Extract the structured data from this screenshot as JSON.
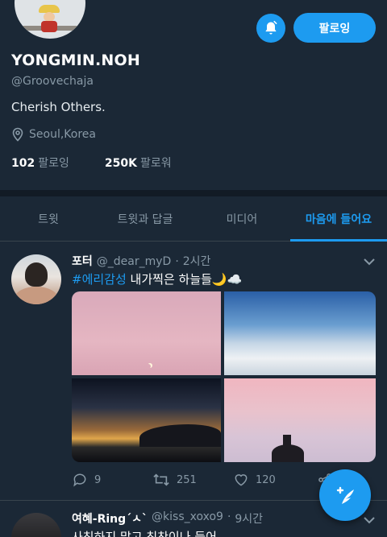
{
  "profile": {
    "name": "YONGMIN.NOH",
    "handle": "@Groovechaja",
    "bio": "Cherish Others.",
    "location": "Seoul,Korea",
    "following_count": "102",
    "following_label": "팔로잉",
    "followers_count": "250K",
    "followers_label": "팔로워",
    "follow_button_label": "팔로잉"
  },
  "tabs": [
    {
      "label": "트윗"
    },
    {
      "label": "트윗과 답글"
    },
    {
      "label": "미디어"
    },
    {
      "label": "마음에 들어요",
      "active": true
    }
  ],
  "tweets": [
    {
      "name": "포터",
      "handle": "@_dear_myD",
      "time": "2시간",
      "hashtag": "#에리감성",
      "text": " 내가찍은 하늘들🌙☁️",
      "replies": "9",
      "retweets": "251",
      "likes": "120"
    },
    {
      "name": "여혜-Ring´ㅅ`",
      "handle": "@kiss_xoxo9",
      "time": "9시간",
      "text": "사칭하지 말고 칭찬이나 들어"
    }
  ],
  "icons": {
    "bell": "bell-icon",
    "location": "location-pin-icon",
    "chevron": "chevron-down-icon",
    "reply": "reply-icon",
    "retweet": "retweet-icon",
    "like": "heart-icon",
    "share": "share-icon",
    "compose": "compose-tweet-icon"
  },
  "colors": {
    "background": "#1b2836",
    "accent": "#1d9bf0",
    "secondary_text": "#8899a6",
    "divider": "#38444d"
  }
}
